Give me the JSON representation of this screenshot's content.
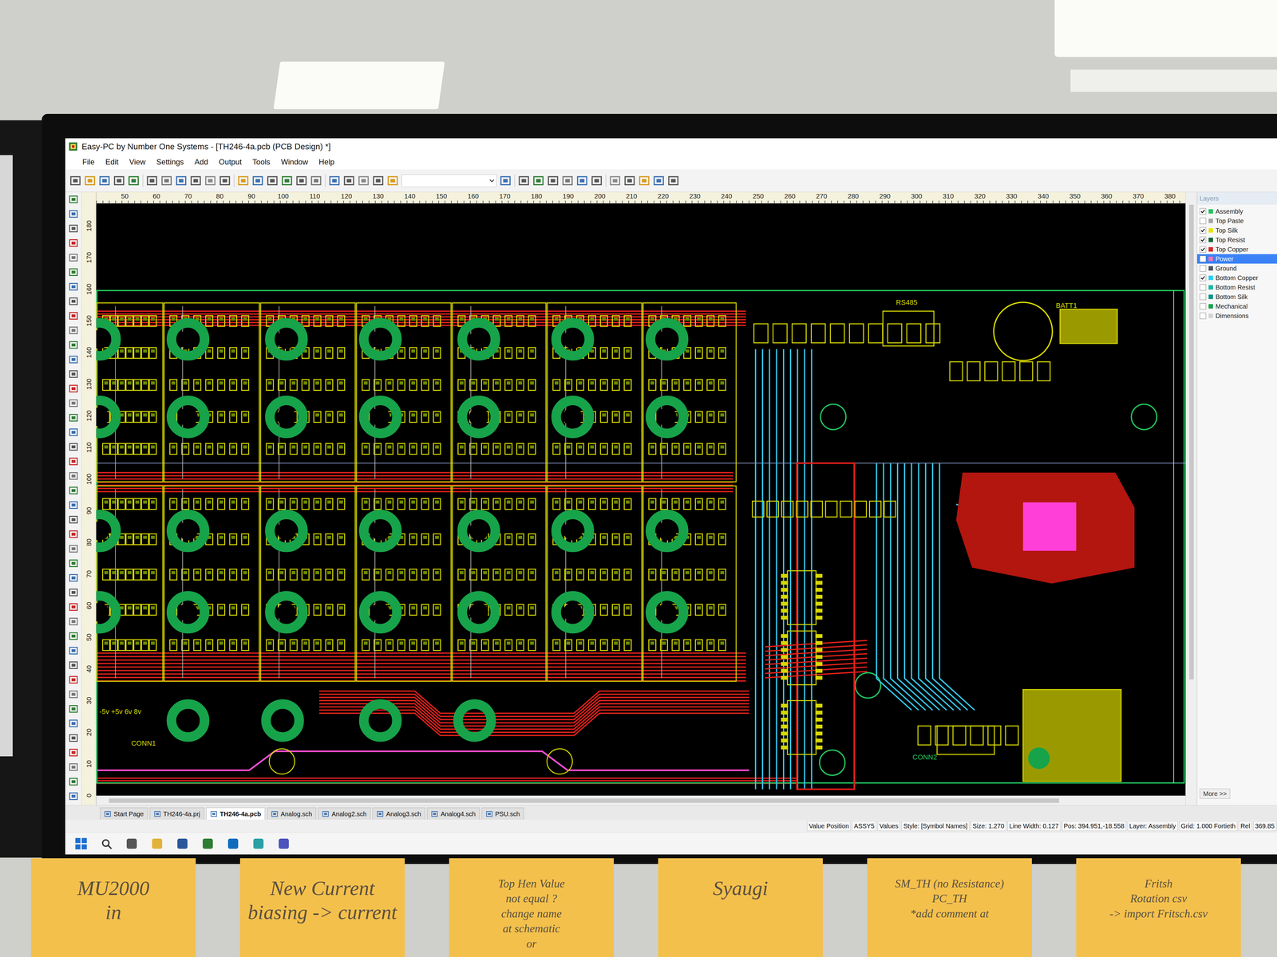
{
  "window": {
    "title": "Easy-PC by Number One Systems - [TH246-4a.pcb (PCB Design) *]"
  },
  "menu": [
    "File",
    "Edit",
    "View",
    "Settings",
    "Add",
    "Output",
    "Tools",
    "Window",
    "Help"
  ],
  "ruler": {
    "horizontal": [
      "50",
      "60",
      "70",
      "80",
      "90",
      "100",
      "110",
      "120",
      "130",
      "140",
      "150",
      "160",
      "170",
      "180",
      "190",
      "200",
      "210",
      "220",
      "230",
      "240",
      "250",
      "260",
      "270",
      "280",
      "290",
      "300",
      "310",
      "320",
      "330",
      "340",
      "350",
      "360",
      "370",
      "380"
    ],
    "vertical": [
      "180",
      "170",
      "160",
      "150",
      "140",
      "130",
      "120",
      "110",
      "100",
      "90",
      "80",
      "70",
      "60",
      "50",
      "40",
      "30",
      "20",
      "10",
      "0"
    ]
  },
  "layers": {
    "title": "Layers",
    "items": [
      {
        "name": "Assembly",
        "checked": true,
        "selected": false,
        "color": "#22c55e"
      },
      {
        "name": "Top Paste",
        "checked": false,
        "selected": false,
        "color": "#a3a3a3"
      },
      {
        "name": "Top Silk",
        "checked": true,
        "selected": false,
        "color": "#e5e510"
      },
      {
        "name": "Top Resist",
        "checked": true,
        "selected": false,
        "color": "#166534"
      },
      {
        "name": "Top Copper",
        "checked": true,
        "selected": false,
        "color": "#dc2626"
      },
      {
        "name": "Power",
        "checked": false,
        "selected": true,
        "color": "#f472b6"
      },
      {
        "name": "Ground",
        "checked": false,
        "selected": false,
        "color": "#4b5563"
      },
      {
        "name": "Bottom Copper",
        "checked": true,
        "selected": false,
        "color": "#22d3ee"
      },
      {
        "name": "Bottom Resist",
        "checked": false,
        "selected": false,
        "color": "#14b8a6"
      },
      {
        "name": "Bottom Silk",
        "checked": false,
        "selected": false,
        "color": "#0d9488"
      },
      {
        "name": "Mechanical",
        "checked": false,
        "selected": false,
        "color": "#16a34a"
      },
      {
        "name": "Dimensions",
        "checked": false,
        "selected": false,
        "color": "#d4d4d4"
      }
    ],
    "more": "More >>"
  },
  "board": {
    "labels": [
      "RS485",
      "BATT1",
      "CONN1",
      "-5v +5v 6v 8v",
      "CONN2"
    ]
  },
  "document_tabs": [
    {
      "label": "Start Page",
      "selected": false
    },
    {
      "label": "TH246-4a.prj",
      "selected": false
    },
    {
      "label": "TH246-4a.pcb",
      "selected": true
    },
    {
      "label": "Analog.sch",
      "selected": false
    },
    {
      "label": "Analog2.sch",
      "selected": false
    },
    {
      "label": "Analog3.sch",
      "selected": false
    },
    {
      "label": "Analog4.sch",
      "selected": false
    },
    {
      "label": "PSU.sch",
      "selected": false
    }
  ],
  "status_bar": [
    "Value Position",
    "ASSY5",
    "Values",
    "Style: [Symbol Names]",
    "Size: 1.270",
    "Line Width: 0.127",
    "Pos: 394.951,-18.558",
    "Layer: Assembly",
    "Grid: 1.000 Fortieth",
    "Rel",
    "369.85"
  ],
  "sticky_notes": [
    {
      "lines": [
        "MU2000",
        "in"
      ]
    },
    {
      "lines": [
        "New Current",
        "biasing -> current"
      ]
    },
    {
      "lines": [
        "Top Hen Value",
        "not equal ?",
        "change name",
        "at schematic",
        "or"
      ]
    },
    {
      "lines": [
        "Syaugi"
      ]
    },
    {
      "lines": [
        "SM_TH (no Resistance)",
        "PC_TH",
        "*add comment at"
      ]
    },
    {
      "lines": [
        "Fritsh",
        "Rotation csv",
        "-> import Fritsch.csv"
      ]
    }
  ]
}
